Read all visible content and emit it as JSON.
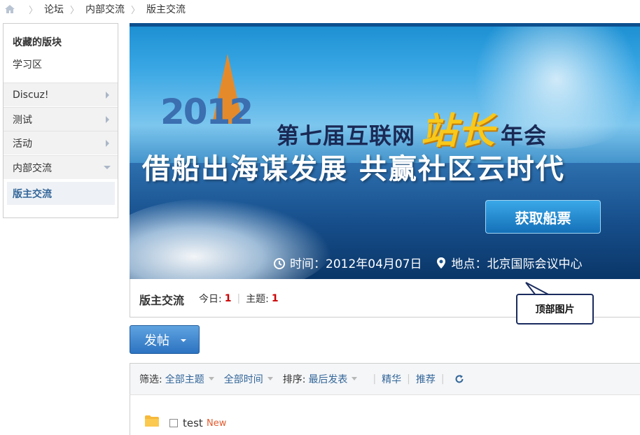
{
  "breadcrumb": {
    "items": [
      "论坛",
      "内部交流",
      "版主交流"
    ]
  },
  "sidebar": {
    "favorites_title": "收藏的版块",
    "favorite_item": "学习区",
    "groups": [
      "Discuz!",
      "测试",
      "活动",
      "内部交流"
    ],
    "active_sub": "版主交流"
  },
  "banner": {
    "year": "2012",
    "headline_pre": "第七届互联网",
    "headline_highlight": "站长",
    "headline_post": "年会",
    "slogan": "借船出海谋发展 共赢社区云时代",
    "ticket_button": "获取船票",
    "time_text": "时间：2012年04月07日",
    "place_text": "地点：北京国际会议中心"
  },
  "forum": {
    "name": "版主交流",
    "today_label": "今日:",
    "today_count": "1",
    "topics_label": "主题:",
    "topics_count": "1"
  },
  "callout": {
    "text": "顶部图片"
  },
  "post_button": {
    "label": "发帖"
  },
  "filters": {
    "filter_label": "筛选:",
    "all_topics": "全部主题",
    "all_time": "全部时间",
    "sort_label": "排序:",
    "last_post": "最后发表",
    "digest": "精华",
    "recommend": "推荐"
  },
  "threads": [
    {
      "title": "test",
      "tag": "New"
    }
  ],
  "colors": {
    "link": "#336699",
    "count": "#cc0000",
    "new_tag": "#e35b2e",
    "button": "#2c73c1"
  }
}
